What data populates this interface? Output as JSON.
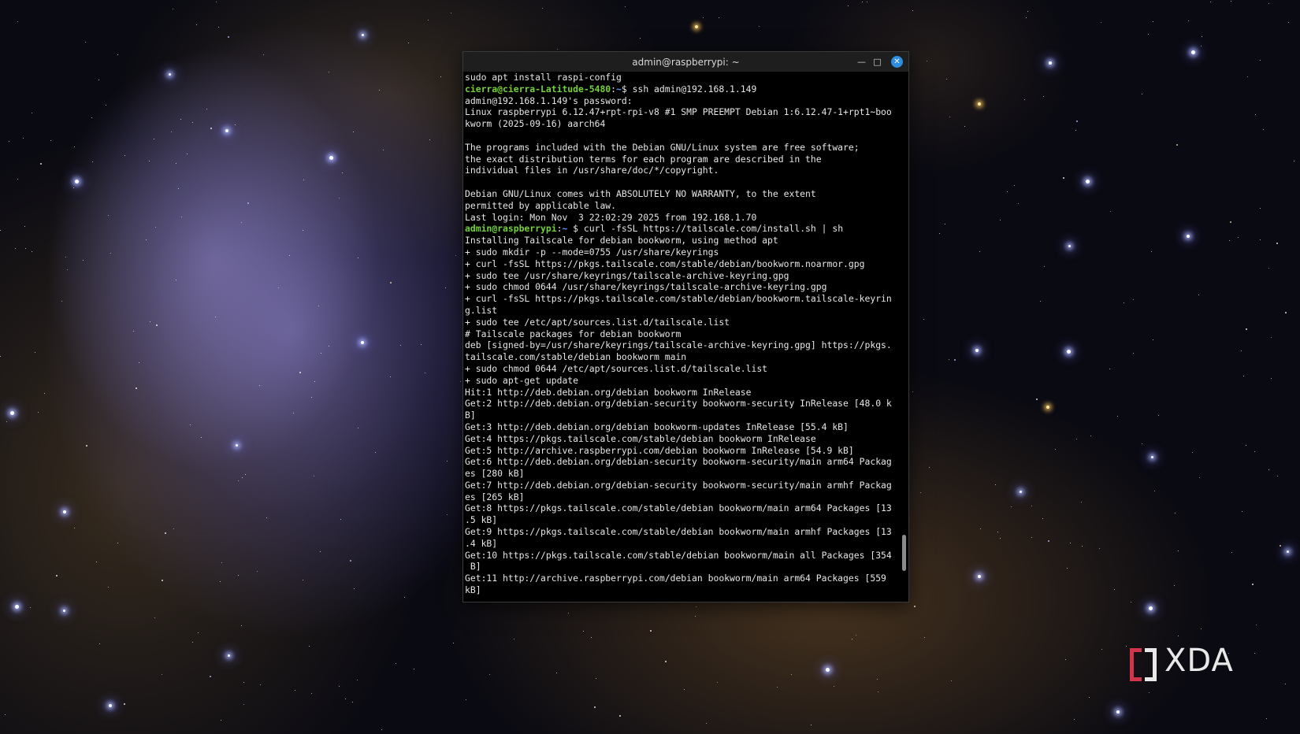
{
  "window": {
    "title": "admin@raspberrypi: ~",
    "minimize_icon": "minimize-icon",
    "maximize_icon": "maximize-icon",
    "close_icon": "close-icon"
  },
  "terminal": {
    "lines": [
      [
        {
          "t": "sudo apt install raspi-config"
        }
      ],
      [
        {
          "t": "cierra@cierra-Latitude-5480",
          "c": "user"
        },
        {
          "t": ":",
          "c": ""
        },
        {
          "t": "~",
          "c": "path"
        },
        {
          "t": "$ ssh admin@192.168.1.149"
        }
      ],
      [
        {
          "t": "admin@192.168.1.149's password:"
        }
      ],
      [
        {
          "t": "Linux raspberrypi 6.12.47+rpt-rpi-v8 #1 SMP PREEMPT Debian 1:6.12.47-1+rpt1~boo"
        }
      ],
      [
        {
          "t": "kworm (2025-09-16) aarch64"
        }
      ],
      [
        {
          "t": ""
        }
      ],
      [
        {
          "t": "The programs included with the Debian GNU/Linux system are free software;"
        }
      ],
      [
        {
          "t": "the exact distribution terms for each program are described in the"
        }
      ],
      [
        {
          "t": "individual files in /usr/share/doc/*/copyright."
        }
      ],
      [
        {
          "t": ""
        }
      ],
      [
        {
          "t": "Debian GNU/Linux comes with ABSOLUTELY NO WARRANTY, to the extent"
        }
      ],
      [
        {
          "t": "permitted by applicable law."
        }
      ],
      [
        {
          "t": "Last login: Mon Nov  3 22:02:29 2025 from 192.168.1.70"
        }
      ],
      [
        {
          "t": "admin@raspberrypi",
          "c": "user"
        },
        {
          "t": ":",
          "c": ""
        },
        {
          "t": "~",
          "c": "path"
        },
        {
          "t": " $ curl -fsSL https://tailscale.com/install.sh | sh"
        }
      ],
      [
        {
          "t": "Installing Tailscale for debian bookworm, using method apt"
        }
      ],
      [
        {
          "t": "+ sudo mkdir -p --mode=0755 /usr/share/keyrings"
        }
      ],
      [
        {
          "t": "+ curl -fsSL https://pkgs.tailscale.com/stable/debian/bookworm.noarmor.gpg"
        }
      ],
      [
        {
          "t": "+ sudo tee /usr/share/keyrings/tailscale-archive-keyring.gpg"
        }
      ],
      [
        {
          "t": "+ sudo chmod 0644 /usr/share/keyrings/tailscale-archive-keyring.gpg"
        }
      ],
      [
        {
          "t": "+ curl -fsSL https://pkgs.tailscale.com/stable/debian/bookworm.tailscale-keyrin"
        }
      ],
      [
        {
          "t": "g.list"
        }
      ],
      [
        {
          "t": "+ sudo tee /etc/apt/sources.list.d/tailscale.list"
        }
      ],
      [
        {
          "t": "# Tailscale packages for debian bookworm"
        }
      ],
      [
        {
          "t": "deb [signed-by=/usr/share/keyrings/tailscale-archive-keyring.gpg] https://pkgs."
        }
      ],
      [
        {
          "t": "tailscale.com/stable/debian bookworm main"
        }
      ],
      [
        {
          "t": "+ sudo chmod 0644 /etc/apt/sources.list.d/tailscale.list"
        }
      ],
      [
        {
          "t": "+ sudo apt-get update"
        }
      ],
      [
        {
          "t": "Hit:1 http://deb.debian.org/debian bookworm InRelease"
        }
      ],
      [
        {
          "t": "Get:2 http://deb.debian.org/debian-security bookworm-security InRelease [48.0 k"
        }
      ],
      [
        {
          "t": "B]"
        }
      ],
      [
        {
          "t": "Get:3 http://deb.debian.org/debian bookworm-updates InRelease [55.4 kB]"
        }
      ],
      [
        {
          "t": "Get:4 https://pkgs.tailscale.com/stable/debian bookworm InRelease"
        }
      ],
      [
        {
          "t": "Get:5 http://archive.raspberrypi.com/debian bookworm InRelease [54.9 kB]"
        }
      ],
      [
        {
          "t": "Get:6 http://deb.debian.org/debian-security bookworm-security/main arm64 Packag"
        }
      ],
      [
        {
          "t": "es [280 kB]"
        }
      ],
      [
        {
          "t": "Get:7 http://deb.debian.org/debian-security bookworm-security/main armhf Packag"
        }
      ],
      [
        {
          "t": "es [265 kB]"
        }
      ],
      [
        {
          "t": "Get:8 https://pkgs.tailscale.com/stable/debian bookworm/main arm64 Packages [13"
        }
      ],
      [
        {
          "t": ".5 kB]"
        }
      ],
      [
        {
          "t": "Get:9 https://pkgs.tailscale.com/stable/debian bookworm/main armhf Packages [13"
        }
      ],
      [
        {
          "t": ".4 kB]"
        }
      ],
      [
        {
          "t": "Get:10 https://pkgs.tailscale.com/stable/debian bookworm/main all Packages [354"
        }
      ],
      [
        {
          "t": " B]"
        }
      ],
      [
        {
          "t": "Get:11 http://archive.raspberrypi.com/debian bookworm/main arm64 Packages [559"
        }
      ],
      [
        {
          "t": "kB]"
        }
      ]
    ]
  },
  "watermark": {
    "text": "XDA",
    "accent_color": "#d2354b"
  },
  "colors": {
    "prompt_user": "#74d13a",
    "prompt_path": "#5a8df0",
    "close_button": "#2d8de0"
  }
}
